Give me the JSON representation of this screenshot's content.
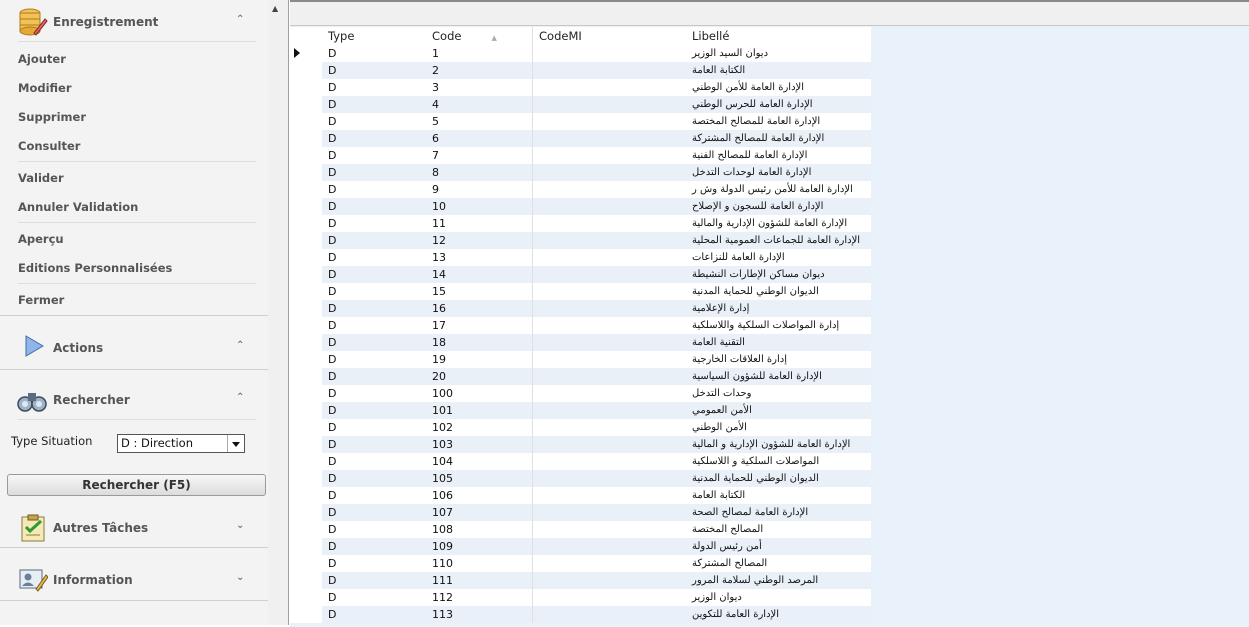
{
  "sidebar": {
    "enregistrement": {
      "title": "Enregistrement",
      "items": [
        "Ajouter",
        "Modifier",
        "Supprimer",
        "Consulter",
        "Valider",
        "Annuler Validation",
        "Aperçu",
        "Editions Personnalisées",
        "Fermer"
      ]
    },
    "actions": {
      "title": "Actions"
    },
    "rechercher": {
      "title": "Rechercher",
      "type_label": "Type Situation",
      "type_value": "D : Direction",
      "button": "Rechercher (F5)"
    },
    "autres": {
      "title": "Autres Tâches"
    },
    "information": {
      "title": "Information"
    }
  },
  "grid": {
    "columns": [
      "Type",
      "Code",
      "CodeMI",
      "Libellé"
    ],
    "rows": [
      {
        "type": "D",
        "code": "1",
        "codemi": "",
        "libelle": "ديوان السيد الوزير"
      },
      {
        "type": "D",
        "code": "2",
        "codemi": "",
        "libelle": "الكتابة العامة"
      },
      {
        "type": "D",
        "code": "3",
        "codemi": "",
        "libelle": "الإدارة العامة للأمن الوطني"
      },
      {
        "type": "D",
        "code": "4",
        "codemi": "",
        "libelle": "الإدارة العامة للحرس الوطني"
      },
      {
        "type": "D",
        "code": "5",
        "codemi": "",
        "libelle": "الإدارة العامة للمصالح المختصة"
      },
      {
        "type": "D",
        "code": "6",
        "codemi": "",
        "libelle": "الإدارة العامة للمصالح المشتركة"
      },
      {
        "type": "D",
        "code": "7",
        "codemi": "",
        "libelle": "الإدارة العامة للمصالح الفنية"
      },
      {
        "type": "D",
        "code": "8",
        "codemi": "",
        "libelle": "الإدارة العامة لوحدات التدخل"
      },
      {
        "type": "D",
        "code": "9",
        "codemi": "",
        "libelle": "الإدارة العامة للأمن رئيس الدولة وش ر"
      },
      {
        "type": "D",
        "code": "10",
        "codemi": "",
        "libelle": "الإدارة العامة للسجون و الإصلاح"
      },
      {
        "type": "D",
        "code": "11",
        "codemi": "",
        "libelle": "الإدارة العامة للشؤون الإدارية والمالية"
      },
      {
        "type": "D",
        "code": "12",
        "codemi": "",
        "libelle": "الإدارة العامة للجماعات العمومية المحلية"
      },
      {
        "type": "D",
        "code": "13",
        "codemi": "",
        "libelle": "الإدارة العامة للنزاعات"
      },
      {
        "type": "D",
        "code": "14",
        "codemi": "",
        "libelle": "ديوان مساكن الإطارات النشيطة"
      },
      {
        "type": "D",
        "code": "15",
        "codemi": "",
        "libelle": "الديوان الوطني للحماية المدنية"
      },
      {
        "type": "D",
        "code": "16",
        "codemi": "",
        "libelle": "إدارة الإعلامية"
      },
      {
        "type": "D",
        "code": "17",
        "codemi": "",
        "libelle": "إدارة المواصلات السلكية واللاسلكية"
      },
      {
        "type": "D",
        "code": "18",
        "codemi": "",
        "libelle": "التقنية العامة"
      },
      {
        "type": "D",
        "code": "19",
        "codemi": "",
        "libelle": "إدارة العلاقات الخارجية"
      },
      {
        "type": "D",
        "code": "20",
        "codemi": "",
        "libelle": "الإدارة العامة للشؤون السياسية"
      },
      {
        "type": "D",
        "code": "100",
        "codemi": "",
        "libelle": "وحدات التدخل"
      },
      {
        "type": "D",
        "code": "101",
        "codemi": "",
        "libelle": "الأمن العمومي"
      },
      {
        "type": "D",
        "code": "102",
        "codemi": "",
        "libelle": "الأمن الوطني"
      },
      {
        "type": "D",
        "code": "103",
        "codemi": "",
        "libelle": "الإدارة العامة للشؤون الإدارية و المالية"
      },
      {
        "type": "D",
        "code": "104",
        "codemi": "",
        "libelle": "المواصلات السلكية و اللاسلكية"
      },
      {
        "type": "D",
        "code": "105",
        "codemi": "",
        "libelle": "الديوان الوطني للحماية المدنية"
      },
      {
        "type": "D",
        "code": "106",
        "codemi": "",
        "libelle": "الكتابة العامة"
      },
      {
        "type": "D",
        "code": "107",
        "codemi": "",
        "libelle": "الإدارة العامة لمصالح الصحة"
      },
      {
        "type": "D",
        "code": "108",
        "codemi": "",
        "libelle": "المصالح المختصة"
      },
      {
        "type": "D",
        "code": "109",
        "codemi": "",
        "libelle": "أمن رئيس الدولة"
      },
      {
        "type": "D",
        "code": "110",
        "codemi": "",
        "libelle": "المصالح المشتركة"
      },
      {
        "type": "D",
        "code": "111",
        "codemi": "",
        "libelle": "المرصد الوطني لسلامة المرور"
      },
      {
        "type": "D",
        "code": "112",
        "codemi": "",
        "libelle": "ديوان الوزير"
      },
      {
        "type": "D",
        "code": "113",
        "codemi": "",
        "libelle": "الإدارة العامة للتكوين"
      }
    ]
  }
}
